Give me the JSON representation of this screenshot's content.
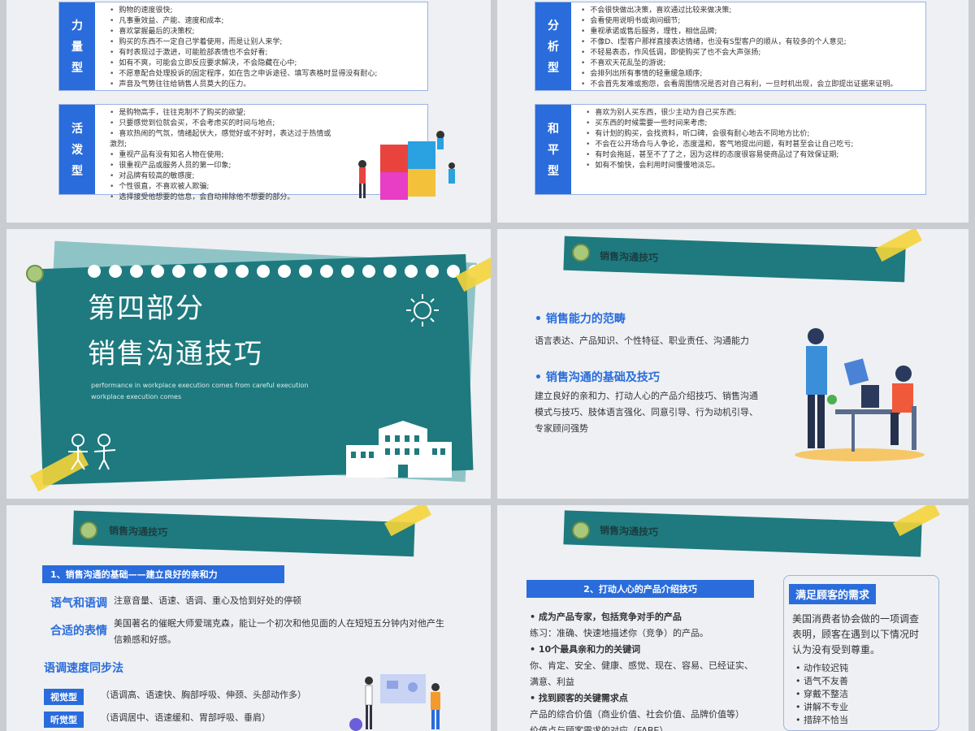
{
  "slide1": {
    "card1": {
      "tag": [
        "力",
        "量",
        "型"
      ],
      "items": [
        "购物的速度很快;",
        "凡事重效益、产能、速度和成本;",
        "喜欢掌握最后的决策权;",
        "购买的东西不一定自己学着使用，而是让别人来学;",
        "有时表现过于激进，可能脸部表情也不会好看;",
        "如有不爽，可能会立即反应要求解决，不会隐藏在心中;",
        "不愿意配合处理投诉的固定程序，如在告之申诉途径、填写表格时显得没有耐心;",
        "声音及气势往往给销售人员莫大的压力。"
      ]
    },
    "card2": {
      "tag": [
        "活",
        "泼",
        "型"
      ],
      "items": [
        "是购物高手，往往克制不了购买的欲望;",
        "只要感觉到位就会买，不会考虑买的时间与地点;",
        "喜欢热闹的气氛，情绪起伏大，感觉好或不好时，表达过于热情或激烈;",
        "重视产品有没有知名人物在使用;",
        "很重视产品或服务人员的第一印象;",
        "对品牌有较高的敏感度;",
        "个性很直，不喜欢被人欺骗;",
        "选择接受他想要的信息，会自动排除他不想要的部分。"
      ]
    }
  },
  "slide2": {
    "card1": {
      "tag": [
        "分",
        "析",
        "型"
      ],
      "items": [
        "不会很快做出决策，喜欢通过比较来做决策;",
        "会看使用说明书或询问细节;",
        "重视承诺或售后服务，理性，相信品牌;",
        "不像D、I型客户那样直接表达情绪，也没有S型客户的顺从，有较多的个人意见;",
        "不轻易表态，作风低调，即使购买了也不会大声张扬;",
        "不喜欢天花乱坠的游说;",
        "会排列出所有事情的轻重缓急顺序;",
        "不会首先发难或抱怨，会看周围情况是否对自己有利，一旦时机出现，会立即提出证据来证明。"
      ]
    },
    "card2": {
      "tag": [
        "和",
        "平",
        "型"
      ],
      "items": [
        "喜欢为别人买东西，很少主动为自己买东西;",
        "买东西的时候需要一些时间来考虑;",
        "有计划的购买，会找资料，听口碑，会很有耐心地去不同地方比价;",
        "不会在公开场合与人争论，态度温和，客气地提出问题，有时甚至会让自己吃亏;",
        "有时会拖延，甚至不了了之，因为这样的态度很容易使商品过了有效保证期;",
        "如有不愉快，会利用时间慢慢地淡忘。"
      ]
    }
  },
  "slide3": {
    "title1": "第四部分",
    "title2": "销售沟通技巧",
    "eng1": "performance in workplace execution comes from careful execution",
    "eng2": "workplace execution comes"
  },
  "slide4": {
    "banner": "销售沟通技巧",
    "h1": "销售能力的范畴",
    "p1": "语言表达、产品知识、个性特征、职业责任、沟通能力",
    "h2": "销售沟通的基础及技巧",
    "p2": [
      "建立良好的亲和力、打动人心的产品介绍技巧、销售沟通",
      "模式与技巧、肢体语言强化、同意引导、行为动机引导、",
      "专家顾问强势"
    ]
  },
  "slide5": {
    "banner": "销售沟通技巧",
    "bar": "1、销售沟通的基础——建立良好的亲和力",
    "k1": "语气和语调",
    "v1": "注意音量、语速、语调、重心及恰到好处的停顿",
    "k2": "合适的表情",
    "v2": [
      "美国著名的催眠大师爱瑞克森，能让一个初次和他见面的人在短短五分钟内对他产生",
      "信赖感和好感。"
    ],
    "h3": "语调速度同步法",
    "t1": "视觉型",
    "d1": "（语调高、语速快、胸部呼吸、伸颈、头部动作多）",
    "t2": "听觉型",
    "d2": "（语调居中、语速缓和、胃部呼吸、垂肩）"
  },
  "slide6": {
    "banner": "销售沟通技巧",
    "bar": "2、打动人心的产品介绍技巧",
    "b1": "成为产品专家，包括竞争对手的产品",
    "b1d": "练习：准确、快速地描述你（竞争）的产品。",
    "b2": "10个最具亲和力的关键词",
    "b2d": [
      "你、肯定、安全、健康、感觉、现在、容易、已经证实、",
      "满意、利益"
    ],
    "b3": "找到顾客的关键需求点",
    "b3d": [
      "产品的综合价值（商业价值、社会价值、品牌价值等）",
      "价值点与顾客需求的对应（FABE）"
    ],
    "side_title": "满足顾客的需求",
    "side_text": [
      "美国消费者协会做的一项调查",
      "表明，顾客在遇到以下情况时",
      "认为没有受到尊重。"
    ],
    "side_items": [
      "动作较迟钝",
      "语气不友善",
      "穿戴不整洁",
      "讲解不专业",
      "措辞不恰当"
    ]
  }
}
